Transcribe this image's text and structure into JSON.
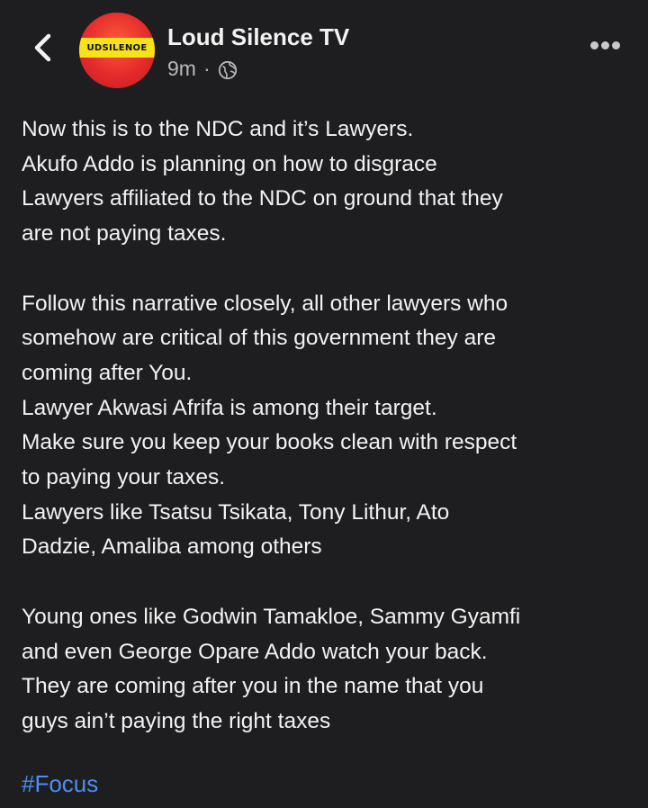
{
  "header": {
    "page_name": "Loud Silence TV",
    "post_time": "9m",
    "separator": "·",
    "avatar_text": "UDSILENOE",
    "icons": {
      "back": "chevron-left-icon",
      "privacy": "globe-icon",
      "more": "more-dots-icon"
    }
  },
  "post": {
    "paragraphs": [
      [
        "Now this is to the NDC and it’s Lawyers.",
        "Akufo Addo is planning on how to disgrace",
        "Lawyers affiliated to the NDC on ground that they",
        "are not paying taxes."
      ],
      [
        "Follow this narrative closely, all other lawyers who",
        "somehow are critical of this government they are",
        "coming after You.",
        "Lawyer Akwasi Afrifa is among their target.",
        "Make sure you keep your books clean with respect",
        "to paying your taxes.",
        "Lawyers like Tsatsu Tsikata, Tony Lithur, Ato",
        "Dadzie, Amaliba among others"
      ],
      [
        "Young ones like Godwin Tamakloe, Sammy Gyamfi",
        "and even George Opare Addo watch your back.",
        "They are coming after you in the name that you",
        "guys ain’t paying the right taxes"
      ]
    ],
    "hashtag": "#Focus"
  },
  "colors": {
    "background": "#1e1e20",
    "text": "#f2f2f2",
    "secondary_text": "#b9b9bd",
    "link": "#4c8df6",
    "avatar_red": "#e52b2b",
    "avatar_yellow": "#f8e21a"
  }
}
